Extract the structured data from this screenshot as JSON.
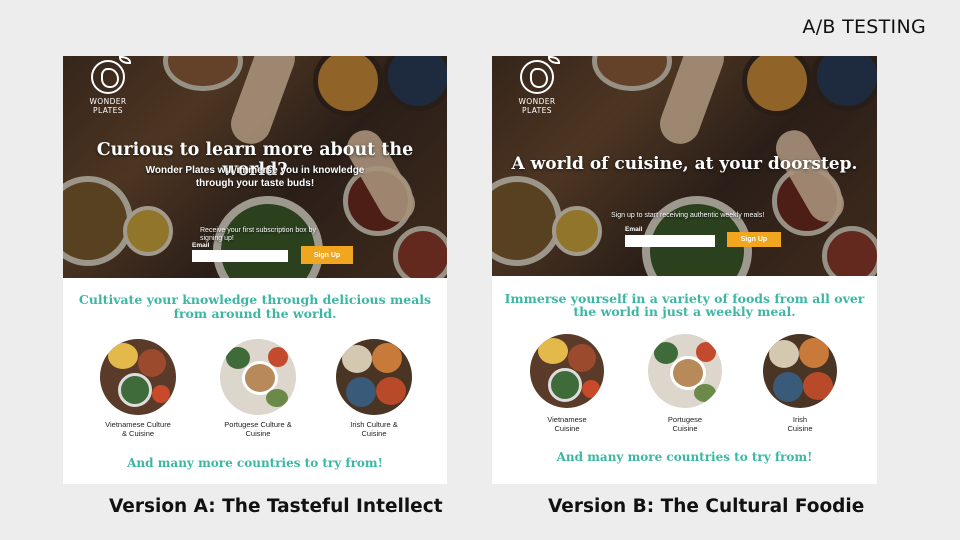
{
  "slide_tag": "A/B TESTING",
  "versions": [
    {
      "brand": [
        "WONDER",
        "PLATES"
      ],
      "headline": "Curious to learn more about the world?",
      "subheadline": [
        "Wonder Plates will immerse you in knowledge",
        "through your taste buds!"
      ],
      "signup_prompt": [
        "Receive your first subscription box by",
        "signing up!"
      ],
      "email_label": "Email",
      "signup_button": "Sign Up",
      "tagline": [
        "Cultivate your knowledge through delicious meals",
        "from around the world."
      ],
      "cuisines": [
        {
          "label": [
            "Vietnamese Culture",
            "& Cuisine"
          ]
        },
        {
          "label": [
            "Portugese Culture &",
            "Cuisine"
          ]
        },
        {
          "label": [
            "Irish Culture &",
            "Cuisine"
          ]
        }
      ],
      "more": "And many more countries to try from!",
      "title": "Version A: The Tasteful Intellect"
    },
    {
      "brand": [
        "WONDER",
        "PLATES"
      ],
      "headline": "A world of cuisine, at your doorstep.",
      "signup_prompt": [
        "Sign up to start receiving authentic weekly meals!"
      ],
      "email_label": "Email",
      "signup_button": "Sign Up",
      "tagline": [
        "Immerse yourself in a variety of foods from all over",
        "the world in just a weekly meal."
      ],
      "cuisines": [
        {
          "label": [
            "Vietnamese",
            "Cuisine"
          ]
        },
        {
          "label": [
            "Portugese",
            "Cuisine"
          ]
        },
        {
          "label": [
            "Irish",
            "Cuisine"
          ]
        }
      ],
      "more": "And many more countries to try from!",
      "title": "Version B: The Cultural Foodie"
    }
  ],
  "colors": {
    "accent_teal": "#3bb7a3",
    "button_orange": "#f0a71f"
  }
}
